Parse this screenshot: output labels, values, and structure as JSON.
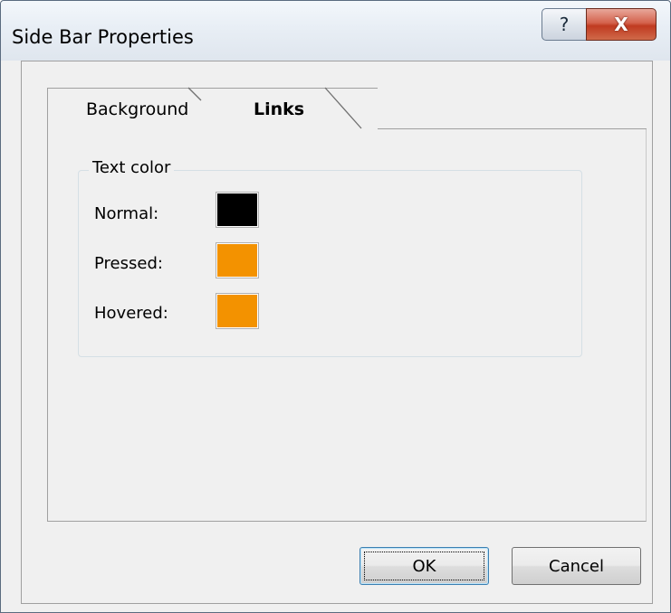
{
  "window": {
    "title": "Side Bar Properties",
    "help_glyph": "?",
    "close_glyph": "X"
  },
  "tabs": [
    {
      "label": "Background",
      "selected": false
    },
    {
      "label": "Links",
      "selected": true
    }
  ],
  "text_color_group": {
    "title": "Text color",
    "rows": [
      {
        "label": "Normal:",
        "color": "#000000"
      },
      {
        "label": "Pressed:",
        "color": "#f39200"
      },
      {
        "label": "Hovered:",
        "color": "#f39200"
      }
    ]
  },
  "buttons": {
    "ok": "OK",
    "cancel": "Cancel"
  }
}
